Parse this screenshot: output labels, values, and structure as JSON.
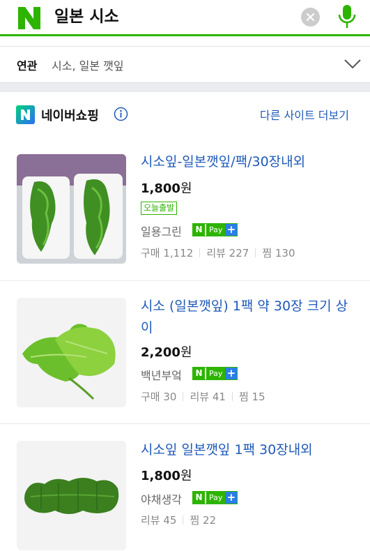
{
  "search": {
    "query": "일본 시소",
    "logo_letter": "N"
  },
  "related": {
    "label": "연관",
    "value": "시소, 일본 깻잎"
  },
  "shopping": {
    "logo_letter": "N",
    "title": "네이버쇼핑",
    "more_link": "다른 사이트 더보기"
  },
  "products": [
    {
      "title": "시소잎-일본깻잎/팩/30장내외",
      "price": "1,800",
      "price_unit": "원",
      "badge": "오늘출발",
      "seller": "일용그린",
      "npay": {
        "n": "N",
        "pay": "Pay",
        "plus": "+"
      },
      "stats": [
        "구매 1,112",
        "리뷰 227",
        "찜 130"
      ]
    },
    {
      "title": "시소 (일본깻잎) 1팩 약 30장 크기 상이",
      "price": "2,200",
      "price_unit": "원",
      "seller": "백년부엌",
      "npay": {
        "n": "N",
        "pay": "Pay",
        "plus": "+"
      },
      "stats": [
        "구매 30",
        "리뷰 41",
        "찜 15"
      ]
    },
    {
      "title": "시소잎 일본깻잎 1팩 30장내외",
      "price": "1,800",
      "price_unit": "원",
      "seller": "야채생각",
      "npay": {
        "n": "N",
        "pay": "Pay",
        "plus": "+"
      },
      "stats": [
        "리뷰 45",
        "찜 22"
      ]
    }
  ],
  "colors": {
    "naver_green": "#2db400",
    "link_blue": "#1f59b8",
    "npay_plus_blue": "#2b7de9"
  }
}
